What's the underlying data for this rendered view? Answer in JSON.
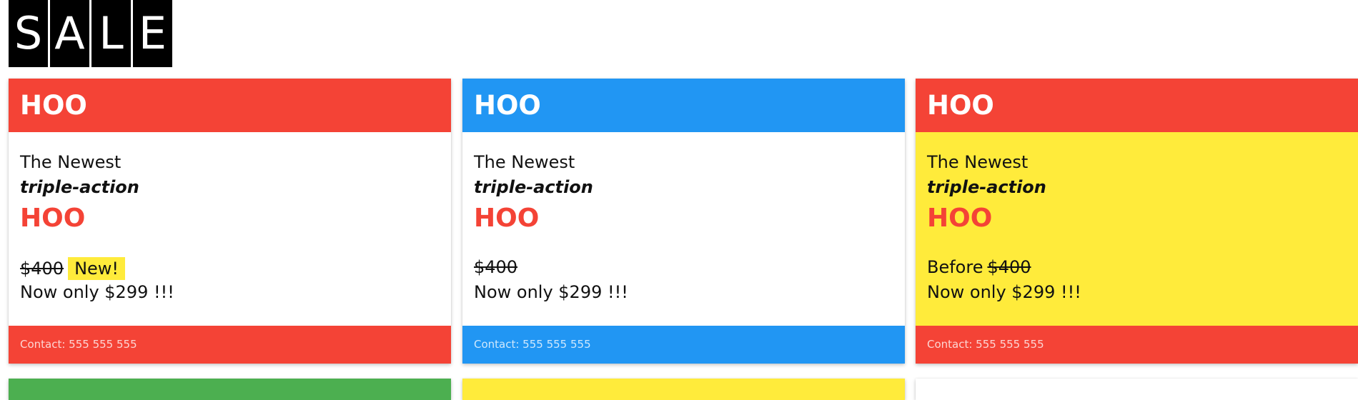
{
  "banner": {
    "letters": [
      "S",
      "A",
      "L",
      "E"
    ]
  },
  "colors": {
    "red": "#f44336",
    "blue": "#2196f3",
    "yellow": "#ffeb3b",
    "green": "#4caf50",
    "white": "#ffffff"
  },
  "cards": [
    {
      "header": "HOO",
      "newest": "The Newest",
      "tagline": "triple-action",
      "product": "HOO",
      "old_price": "$400",
      "badge": "New!",
      "now": "Now only $299 !!!",
      "footer": "Contact: 555 555 555"
    },
    {
      "header": "HOO",
      "newest": "The Newest",
      "tagline": "triple-action",
      "product": "HOO",
      "old_price": "$400",
      "now": "Now only $299 !!!",
      "footer": "Contact: 555 555 555"
    },
    {
      "header": "HOO",
      "newest": "The Newest",
      "tagline": "triple-action",
      "product": "HOO",
      "before": "Before",
      "old_price": "$400",
      "now": "Now only $299 !!!",
      "footer": "Contact: 555 555 555"
    }
  ]
}
